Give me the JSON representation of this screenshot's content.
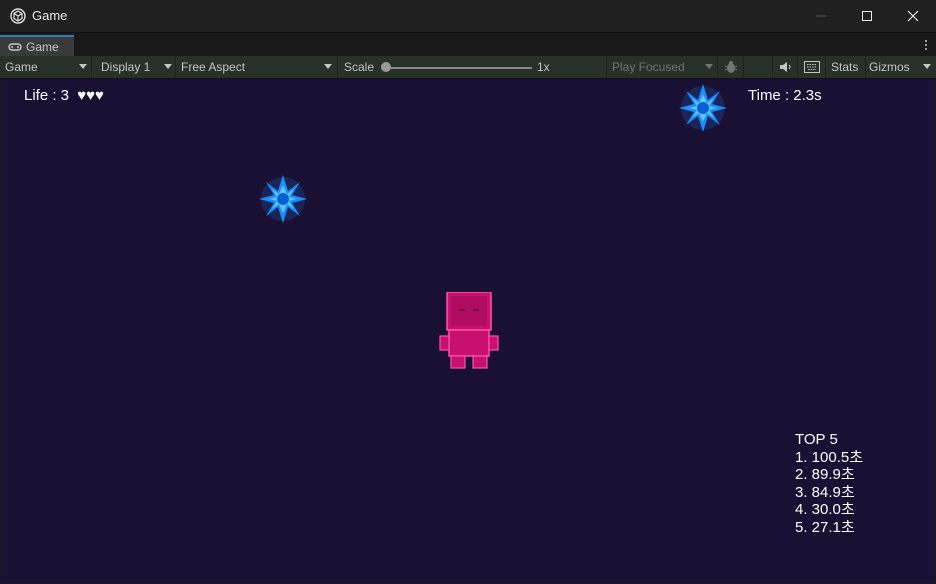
{
  "window": {
    "title": "Game",
    "icon": "unity-logo-icon",
    "controls": [
      "minimize-icon",
      "maximize-icon",
      "close-icon"
    ]
  },
  "tabs": [
    {
      "label": "Game",
      "icon": "gamepad-icon",
      "active": true
    }
  ],
  "toolbar": {
    "view_mode": "Game",
    "display": "Display 1",
    "aspect": "Free Aspect",
    "scale_label": "Scale",
    "scale_value": "1x",
    "play_mode": "Play Focused",
    "stats_label": "Stats",
    "gizmos_label": "Gizmos",
    "icons": [
      "bug-icon",
      "speaker-icon",
      "keyboard-icon"
    ]
  },
  "game": {
    "background_color": "#1a1033",
    "life_label": "Life : 3",
    "life_hearts": "♥♥♥",
    "time_label": "Time : 2.3s",
    "leaderboard": {
      "title": "TOP 5",
      "entries": [
        "1. 100.5초",
        "2. 89.9초",
        "3. 84.9초",
        "4. 30.0초",
        "5. 27.1초"
      ]
    },
    "player_color": "#c8106f",
    "projectile_color": "#1a8cff"
  }
}
